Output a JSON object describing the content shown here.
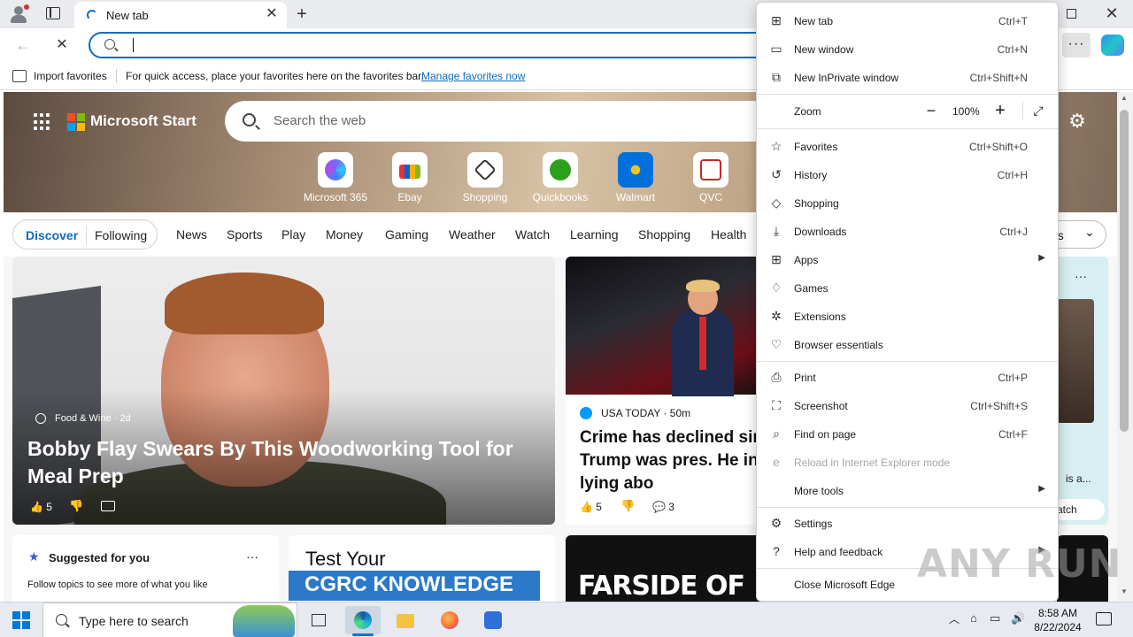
{
  "tab": {
    "title": "New tab"
  },
  "address": {
    "value": ""
  },
  "favbar": {
    "import_label": "Import favorites",
    "message": "For quick access, place your favorites here on the favorites bar.",
    "link": "Manage favorites now"
  },
  "page": {
    "brand": "Microsoft Start",
    "search_placeholder": "Search the web",
    "quicklinks": [
      "Microsoft 365",
      "Ebay",
      "Shopping",
      "Quickbooks",
      "Walmart",
      "QVC"
    ],
    "feed_tabs": {
      "discover": "Discover",
      "following": "Following"
    },
    "nav": [
      "News",
      "Sports",
      "Play",
      "Money",
      "Gaming",
      "Weather",
      "Watch",
      "Learning",
      "Shopping",
      "Health"
    ],
    "settings_partial": "gs",
    "main_card": {
      "source": "Food & Wine · 2d",
      "headline": "Bobby Flay Swears By This Woodworking Tool for Meal Prep",
      "likes": "5"
    },
    "news_card": {
      "source": "USA TODAY · 50m",
      "headline": "Crime has declined since Donald Trump was pres. He insists on lying abo",
      "likes": "5",
      "comments": "3"
    },
    "right_card": {
      "text": "is a...",
      "watch": "atch"
    },
    "suggest_card": {
      "title": "Suggested for you",
      "text": "Follow topics to see more of what you like"
    },
    "ad_card": {
      "line1": "Test Your",
      "line2": "CGRC KNOWLEDGE"
    },
    "farside_card": {
      "text": "FARSIDE OF THE"
    }
  },
  "menu": {
    "items": [
      {
        "label": "New tab",
        "shortcut": "Ctrl+T",
        "icon": "new-tab-icon"
      },
      {
        "label": "New window",
        "shortcut": "Ctrl+N",
        "icon": "new-window-icon"
      },
      {
        "label": "New InPrivate window",
        "shortcut": "Ctrl+Shift+N",
        "icon": "inprivate-icon"
      },
      {
        "label": "Zoom",
        "value": "100%"
      },
      {
        "label": "Favorites",
        "shortcut": "Ctrl+Shift+O",
        "icon": "star-icon"
      },
      {
        "label": "History",
        "shortcut": "Ctrl+H",
        "icon": "history-icon"
      },
      {
        "label": "Shopping",
        "shortcut": "",
        "icon": "tag-icon"
      },
      {
        "label": "Downloads",
        "shortcut": "Ctrl+J",
        "icon": "download-icon"
      },
      {
        "label": "Apps",
        "shortcut": "",
        "icon": "apps-icon"
      },
      {
        "label": "Games",
        "shortcut": "",
        "icon": "games-icon"
      },
      {
        "label": "Extensions",
        "shortcut": "",
        "icon": "extensions-icon"
      },
      {
        "label": "Browser essentials",
        "shortcut": "",
        "icon": "heart-icon"
      },
      {
        "label": "Print",
        "shortcut": "Ctrl+P",
        "icon": "print-icon"
      },
      {
        "label": "Screenshot",
        "shortcut": "Ctrl+Shift+S",
        "icon": "screenshot-icon"
      },
      {
        "label": "Find on page",
        "shortcut": "Ctrl+F",
        "icon": "find-icon"
      },
      {
        "label": "Reload in Internet Explorer mode",
        "shortcut": "",
        "icon": "ie-icon"
      },
      {
        "label": "More tools",
        "shortcut": ""
      },
      {
        "label": "Settings",
        "shortcut": "",
        "icon": "gear-icon"
      },
      {
        "label": "Help and feedback",
        "shortcut": "",
        "icon": "help-icon"
      },
      {
        "label": "Close Microsoft Edge",
        "shortcut": ""
      }
    ]
  },
  "taskbar": {
    "search_placeholder": "Type here to search",
    "time": "8:58 AM",
    "date": "8/22/2024"
  },
  "watermark": "ANY RUN",
  "colors": {
    "accent": "#0f6cbd",
    "taskbar_active": "#0078d4"
  }
}
